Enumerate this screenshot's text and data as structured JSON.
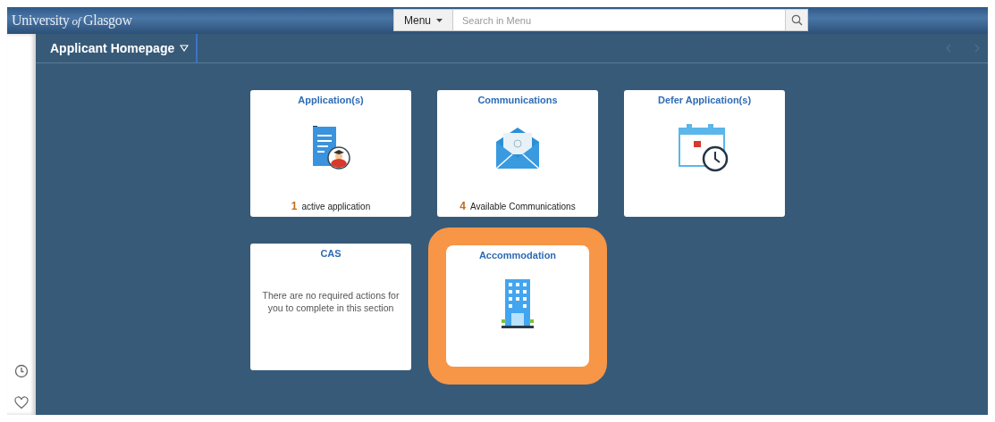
{
  "header": {
    "logo": "University of Glasgow",
    "menu_button": "Menu",
    "search": {
      "placeholder": "Search in Menu"
    }
  },
  "page_title": "Applicant Homepage",
  "tiles": [
    {
      "kind": "count",
      "title": "Application(s)",
      "count": "1",
      "text": "active application",
      "highlighted": false
    },
    {
      "kind": "count",
      "title": "Communications",
      "count": "4",
      "text": "Available Communications",
      "highlighted": false
    },
    {
      "kind": "plain",
      "title": "Defer Application(s)",
      "highlighted": false
    },
    {
      "kind": "message",
      "title": "CAS",
      "text": "There are no required actions for you to complete in this section",
      "highlighted": false
    },
    {
      "kind": "plain",
      "title": "Accommodation",
      "highlighted": true
    }
  ]
}
